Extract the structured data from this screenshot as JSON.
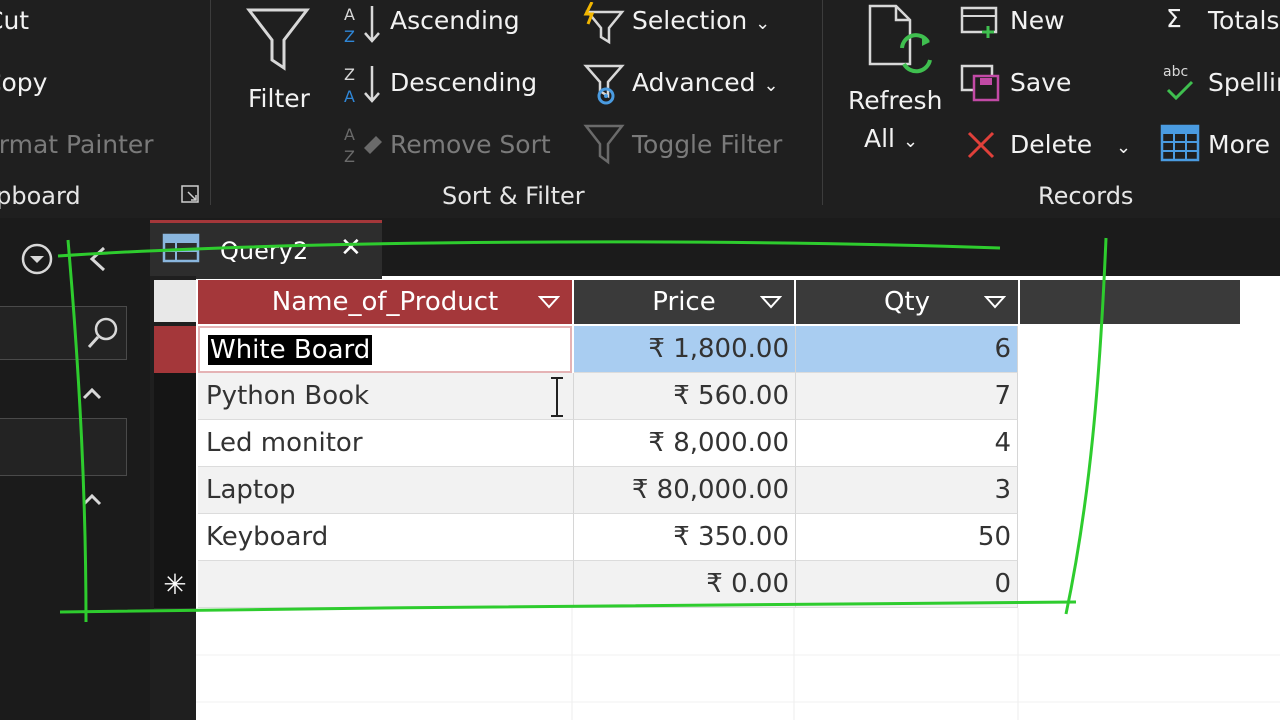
{
  "ribbon": {
    "clipboard": {
      "cut": "Cut",
      "copy": "Copy",
      "format_painter": "Format Painter",
      "group_label": "Clipboard"
    },
    "sort_filter": {
      "filter": "Filter",
      "ascending": "Ascending",
      "descending": "Descending",
      "remove_sort": "Remove Sort",
      "selection": "Selection",
      "advanced": "Advanced",
      "toggle_filter": "Toggle Filter",
      "group_label": "Sort & Filter"
    },
    "records": {
      "refresh": "Refresh",
      "refresh_all": "All",
      "new": "New",
      "save": "Save",
      "delete": "Delete",
      "totals": "Totals",
      "spelling": "Spelling",
      "more": "More",
      "group_label": "Records"
    }
  },
  "tab": {
    "label": "Query2",
    "close": "✕"
  },
  "datasheet": {
    "columns": [
      "Name_of_Product",
      "Price",
      "Qty"
    ],
    "rows": [
      {
        "name": "White Board",
        "price": "₹ 1,800.00",
        "qty": "6"
      },
      {
        "name": "Python Book",
        "price": "₹ 560.00",
        "qty": "7"
      },
      {
        "name": "Led monitor",
        "price": "₹ 8,000.00",
        "qty": "4"
      },
      {
        "name": "Laptop",
        "price": "₹ 80,000.00",
        "qty": "3"
      },
      {
        "name": "Keyboard",
        "price": "₹ 350.00",
        "qty": "50"
      }
    ],
    "new_row": {
      "marker": "✳",
      "price": "₹ 0.00",
      "qty": "0"
    }
  },
  "colors": {
    "accent": "#a4373a",
    "selection": "#a9cdf1",
    "annotation": "#2ecc2e"
  }
}
